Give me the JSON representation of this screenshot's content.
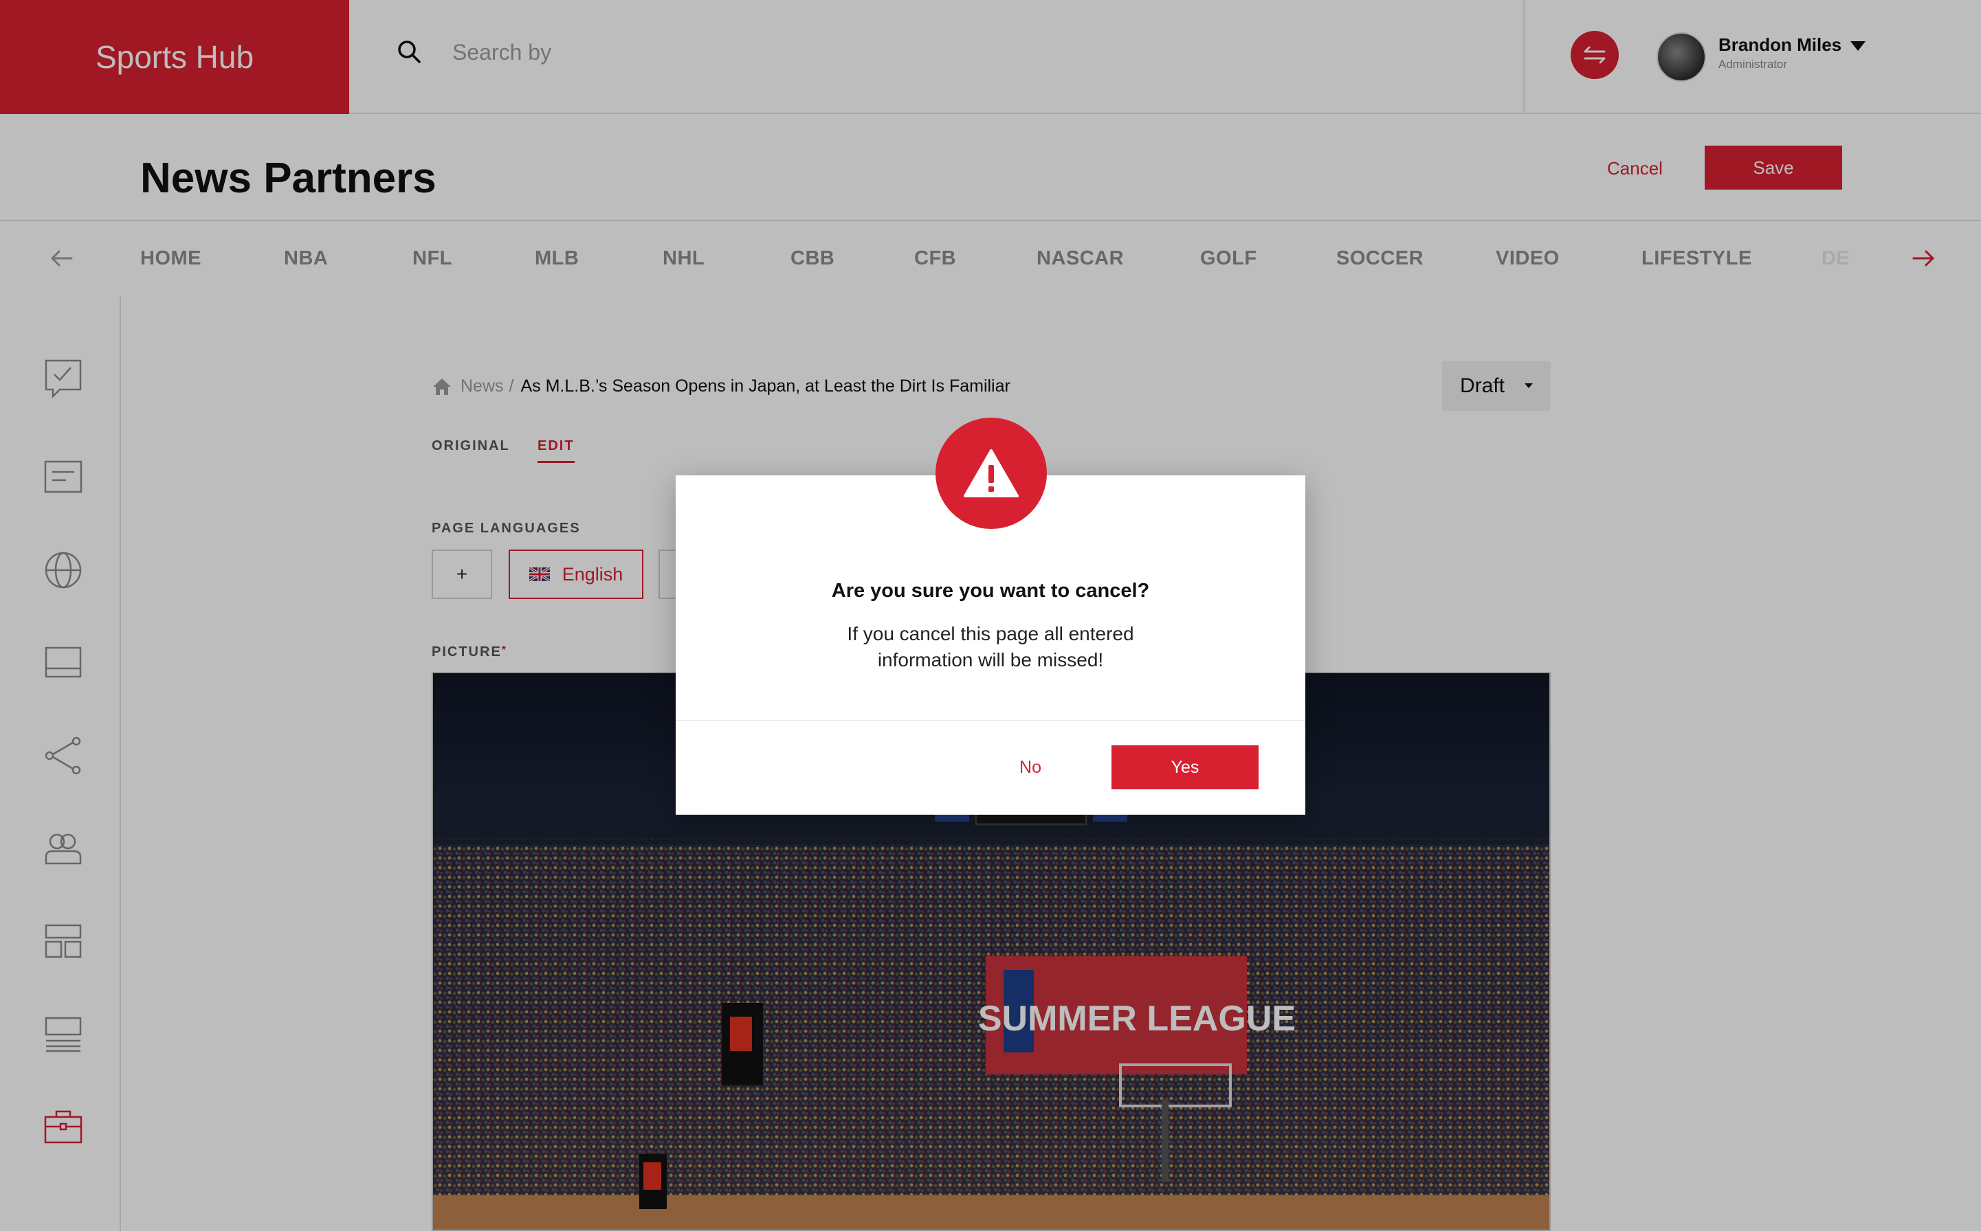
{
  "app": {
    "brand": "Sports Hub"
  },
  "search": {
    "placeholder": "Search by"
  },
  "user": {
    "name": "Brandon Miles",
    "role": "Administrator"
  },
  "page": {
    "title": "News Partners",
    "cancel_label": "Cancel",
    "save_label": "Save"
  },
  "categories": [
    "HOME",
    "NBA",
    "NFL",
    "MLB",
    "NHL",
    "CBB",
    "CFB",
    "NASCAR",
    "GOLF",
    "SOCCER",
    "VIDEO",
    "LIFESTYLE",
    "DE"
  ],
  "sidebar": {
    "items": [
      {
        "icon": "checklist-chat-icon"
      },
      {
        "icon": "document-icon"
      },
      {
        "icon": "globe-icon"
      },
      {
        "icon": "layout-icon"
      },
      {
        "icon": "share-icon"
      },
      {
        "icon": "users-icon"
      },
      {
        "icon": "dashboard-icon"
      },
      {
        "icon": "list-icon"
      },
      {
        "icon": "briefcase-icon",
        "active": true
      }
    ]
  },
  "breadcrumb": {
    "section": "News",
    "separator": "/",
    "current": "As M.L.B.’s Season Opens in Japan, at Least the Dirt Is Familiar"
  },
  "status": {
    "selected": "Draft"
  },
  "tabs": {
    "original": "ORIGINAL",
    "edit": "EDIT"
  },
  "languages": {
    "label": "PAGE LANGUAGES",
    "add": "+",
    "items": [
      "English"
    ]
  },
  "picture": {
    "label": "PICTURE",
    "required_mark": "*",
    "banner_text": "SUMMER LEAGUE"
  },
  "modal": {
    "title": "Are you sure you want to cancel?",
    "message": "If you cancel this page all entered\ninformation will be missed!",
    "no_label": "No",
    "yes_label": "Yes"
  },
  "colors": {
    "accent": "#d72130",
    "overlay": "rgba(0,0,0,0.26)"
  }
}
